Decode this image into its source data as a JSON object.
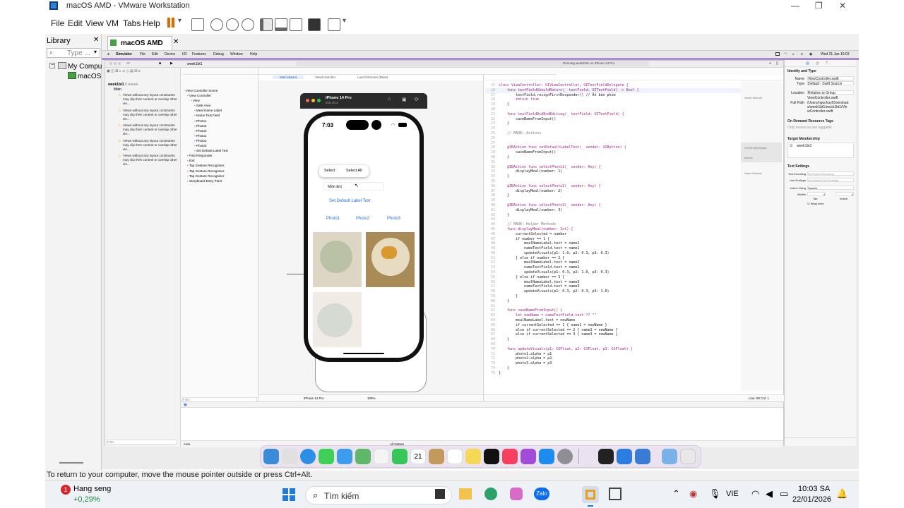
{
  "window": {
    "title": "macOS AMD - VMware Workstation"
  },
  "vmware_menu": [
    "File",
    "Edit",
    "View",
    "VM",
    "Tabs",
    "Help"
  ],
  "library": {
    "title": "Library",
    "search_placeholder": "Type ...",
    "items": [
      "My Compu",
      "macOS"
    ]
  },
  "vm_tab": {
    "label": "macOS AMD"
  },
  "mac_menubar": {
    "apple": "",
    "items": [
      "Simulator",
      "File",
      "Edit",
      "Device",
      "I/O",
      "Features",
      "Debug",
      "Window",
      "Help"
    ],
    "clock": "Wed 21 Jan  19:03"
  },
  "xcode": {
    "top_tab": "week1bt1",
    "project": "week1bt1",
    "issues_count": "6 issues",
    "group": "Main",
    "status": "Running week1bt1 on iPhone 14 Pro",
    "editor_tabs": [
      "Main (Base)",
      "ViewController",
      "LaunchScreen (Base)"
    ],
    "warnings": [
      "Views without any layout constraints may clip their content or overlap other vie...",
      "Views without any layout constraints may clip their content or overlap other vie...",
      "Views without any layout constraints may clip their content or overlap other vie...",
      "Views without any layout constraints may clip their content or overlap other vie...",
      "Views without any layout constraints may clip their content or overlap other vie..."
    ],
    "scene_tree": [
      "View Controller Scene",
      "View Controller",
      "View",
      "Safe Area",
      "Meal Name Label",
      "Name Text Field",
      "Photo1",
      "Photo2",
      "Photo3",
      "Photo1",
      "Photo2",
      "Photo3",
      "Set Default Label Text",
      "First Responder",
      "Exit",
      "Tap Gesture Recognizer",
      "Tap Gesture Recognizer",
      "Tap Gesture Recognizer",
      "Storyboard Entry Point"
    ],
    "canvas_device": "iPhone 14 Pro",
    "zoom": "100%",
    "filter_placeholder": "Filter",
    "debug_scope": "Auto",
    "output_scope": "All Output",
    "cursor_pos": "Line: 80  Col: 1",
    "code_lines": [
      {
        "n": "15",
        "t": "class ViewController: UIViewController, UITextFieldDelegate {"
      },
      {
        "n": "16",
        "t": "    func textFieldShouldReturn(_ textField: UITextField) -> Bool {"
      },
      {
        "n": "17",
        "t": "        textField.resignFirstResponder() // Ẩn bàn phím"
      },
      {
        "n": "18",
        "t": "        return true"
      },
      {
        "n": "19",
        "t": "    }"
      },
      {
        "n": "20",
        "t": ""
      },
      {
        "n": "21",
        "t": "    func textFieldDidEndEditing(_ textField: UITextField) {"
      },
      {
        "n": "22",
        "t": "        saveNameFromInput()"
      },
      {
        "n": "23",
        "t": "    }"
      },
      {
        "n": "24",
        "t": ""
      },
      {
        "n": "25",
        "t": "    // MARK: Actions"
      },
      {
        "n": "26",
        "t": ""
      },
      {
        "n": "27",
        "t": ""
      },
      {
        "n": "28",
        "t": "    @IBAction func setDefaultLabelText(_ sender: UIButton) {"
      },
      {
        "n": "29",
        "t": "        saveNameFromInput()"
      },
      {
        "n": "30",
        "t": "    }"
      },
      {
        "n": "31",
        "t": ""
      },
      {
        "n": "32",
        "t": "    @IBAction func selectPhoto1(_ sender: Any) {"
      },
      {
        "n": "33",
        "t": "        displayMeal(number: 1)"
      },
      {
        "n": "34",
        "t": "    }"
      },
      {
        "n": "35",
        "t": ""
      },
      {
        "n": "36",
        "t": "    @IBAction func selectPhoto2(_ sender: Any) {"
      },
      {
        "n": "37",
        "t": "        displayMeal(number: 2)"
      },
      {
        "n": "38",
        "t": "    }"
      },
      {
        "n": "39",
        "t": ""
      },
      {
        "n": "40",
        "t": "    @IBAction func selectPhoto3(_ sender: Any) {"
      },
      {
        "n": "41",
        "t": "        displayMeal(number: 3)"
      },
      {
        "n": "42",
        "t": "    }"
      },
      {
        "n": "43",
        "t": ""
      },
      {
        "n": "44",
        "t": "    // MARK: Helper Methods"
      },
      {
        "n": "45",
        "t": "    func displayMeal(number: Int) {"
      },
      {
        "n": "46",
        "t": "        currentSelected = number"
      },
      {
        "n": "47",
        "t": "        if number == 1 {"
      },
      {
        "n": "48",
        "t": "            mealNameLabel.text = name1"
      },
      {
        "n": "49",
        "t": "            nameTextField.text = name1"
      },
      {
        "n": "50",
        "t": "            updateVisuals(p1: 1.0, p2: 0.3, p3: 0.3)"
      },
      {
        "n": "51",
        "t": "        } else if number == 2 {"
      },
      {
        "n": "52",
        "t": "            mealNameLabel.text = name2"
      },
      {
        "n": "53",
        "t": "            nameTextField.text = name2"
      },
      {
        "n": "54",
        "t": "            updateVisuals(p1: 0.3, p2: 1.0, p3: 0.3)"
      },
      {
        "n": "55",
        "t": "        } else if number == 3 {"
      },
      {
        "n": "56",
        "t": "            mealNameLabel.text = name3"
      },
      {
        "n": "57",
        "t": "            nameTextField.text = name3"
      },
      {
        "n": "58",
        "t": "            updateVisuals(p1: 0.3, p2: 0.3, p3: 1.0)"
      },
      {
        "n": "59",
        "t": "        }"
      },
      {
        "n": "60",
        "t": "    }"
      },
      {
        "n": "61",
        "t": ""
      },
      {
        "n": "62",
        "t": "    func saveNameFromInput() {"
      },
      {
        "n": "63",
        "t": "        let newName = nameTextField.text ?? \"\""
      },
      {
        "n": "64",
        "t": "        mealNameLabel.text = newName"
      },
      {
        "n": "65",
        "t": "        if currentSelected == 1 { name1 = newName }"
      },
      {
        "n": "66",
        "t": "        else if currentSelected == 2 { name2 = newName }"
      },
      {
        "n": "67",
        "t": "        else if currentSelected == 3 { name3 = newName }"
      },
      {
        "n": "68",
        "t": "    }"
      },
      {
        "n": "69",
        "t": ""
      },
      {
        "n": "70",
        "t": "    func updateVisuals(p1: CGFloat, p2: CGFloat, p3: CGFloat) {"
      },
      {
        "n": "71",
        "t": "        photo1.alpha = p1"
      },
      {
        "n": "72",
        "t": "        photo2.alpha = p2"
      },
      {
        "n": "73",
        "t": "        photo3.alpha = p3"
      },
      {
        "n": "74",
        "t": "    }"
      },
      {
        "n": "75",
        "t": "}"
      }
    ],
    "minimap_labels": [
      "Viewer Methods",
      "UITextFieldDelegate",
      "Actions",
      "Helper Methods"
    ]
  },
  "inspector": {
    "section1": "Identity and Type",
    "name_label": "Name",
    "name_value": "ViewController.swift",
    "type_label": "Type",
    "type_value": "Default - Swift Source",
    "location_label": "Location",
    "location_value": "Relative to Group",
    "file_value": "ViewController.swift",
    "fullpath_label": "Full Path",
    "fullpath_value": "/Users/ngochuy/Downloads/week1bt1/week1bt1/ViewController.swift",
    "section2": "On Demand Resource Tags",
    "tags_placeholder": "Only resources are taggable",
    "section3": "Target Membership",
    "target": "week1bt1",
    "section4": "Text Settings",
    "encoding_label": "Text Encoding",
    "encoding_value": "No Explicit Encoding",
    "endings_label": "Line Endings",
    "endings_value": "No Explicit Line Endings",
    "indent_label": "Indent Using",
    "indent_value": "Spaces",
    "widths_label": "Widths",
    "tab_value": "4",
    "indent_value_num": "4",
    "tab_label": "Tab",
    "indent_label2": "Indent",
    "wrap": "Wrap lines"
  },
  "simulator": {
    "device": "iPhone 14 Pro",
    "ios": "iOS 16.2",
    "time": "7:03",
    "select": "Select",
    "select_all": "Select All",
    "field_text": "Món ăn",
    "button_label": "Set Default Label Text",
    "photos": [
      "Photo1",
      "Photo2",
      "Photo3"
    ]
  },
  "vm_status": "To return to your computer, move the mouse pointer outside or press Ctrl+Alt.",
  "taskbar": {
    "stock_name": "Hang seng",
    "stock_change": "+0,29%",
    "badge": "1",
    "search_placeholder": "Tìm kiếm",
    "lang": "VIE",
    "time": "10:03 SA",
    "date": "22/01/2026"
  },
  "colors": {
    "accent": "#0a66d8",
    "purple": "#a98bd1",
    "warning": "#f2b200"
  }
}
